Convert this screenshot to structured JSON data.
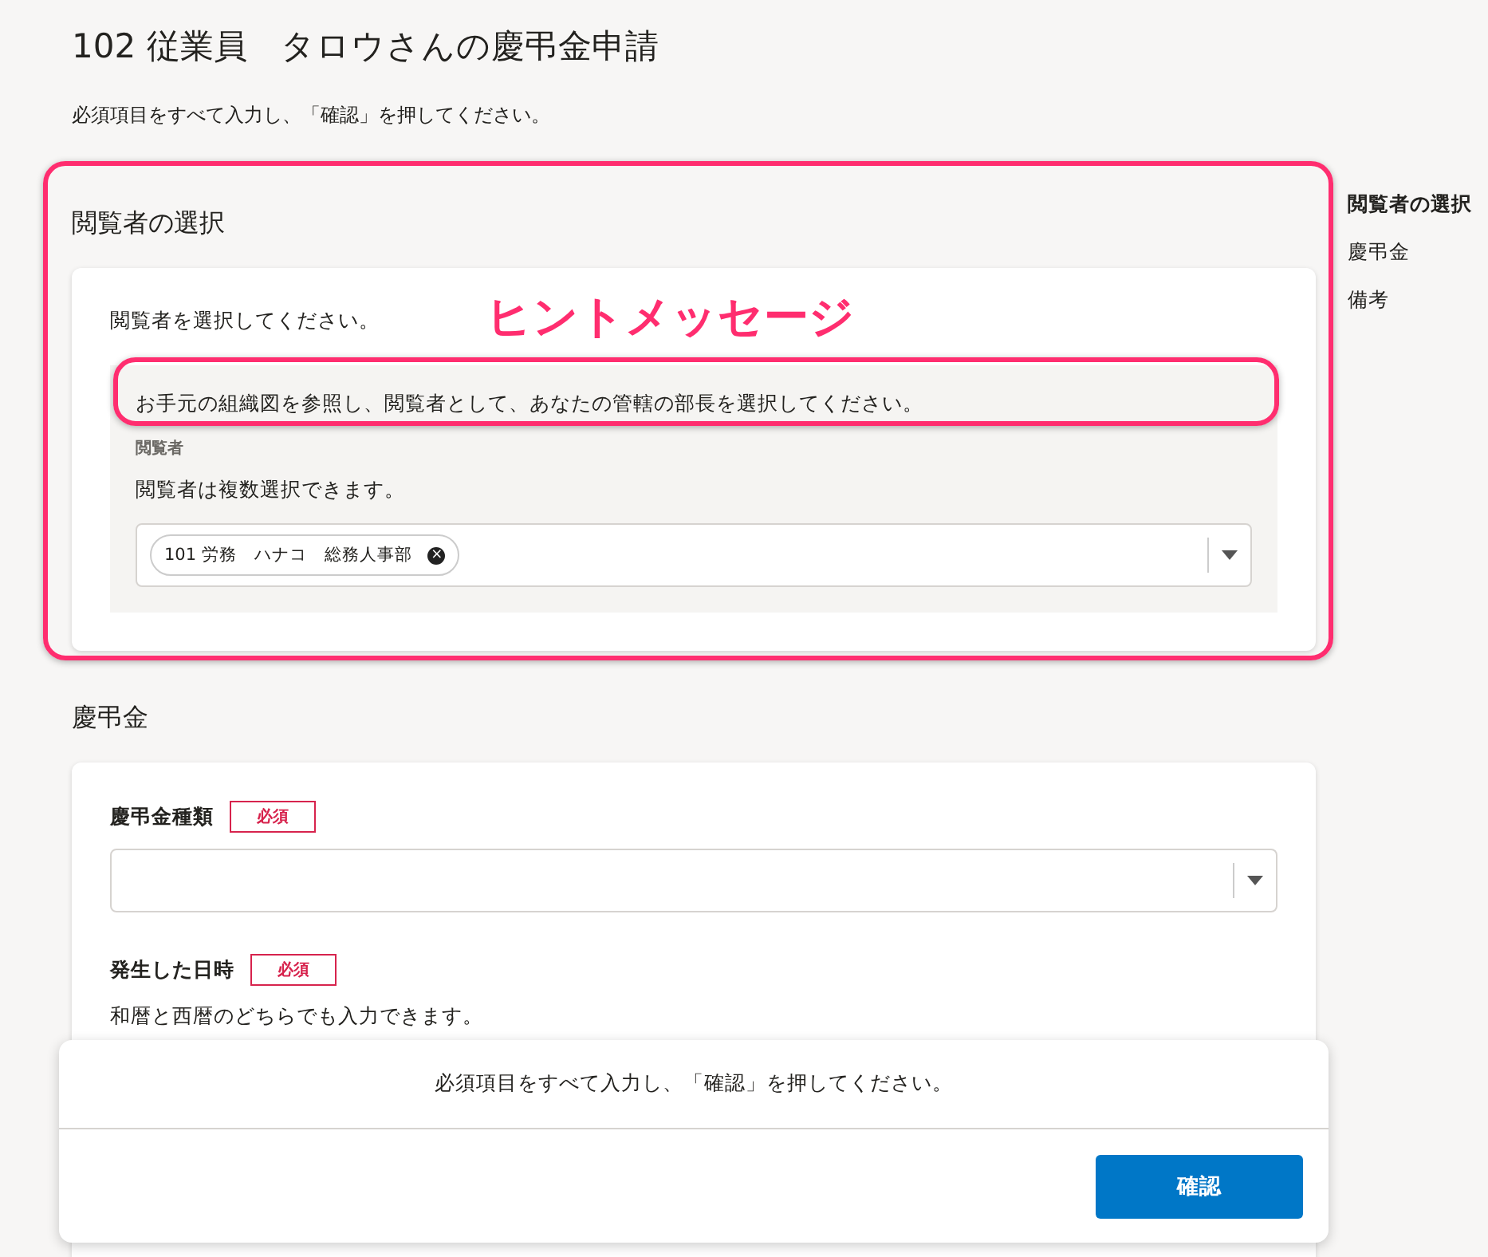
{
  "page": {
    "title": "102 従業員　タロウさんの慶弔金申請",
    "instruction": "必須項目をすべて入力し、「確認」を押してください。"
  },
  "sections": [
    {
      "kind": "viewer",
      "heading": "閲覧者の選択",
      "prompt": "閲覧者を選択してください。",
      "hint": "お手元の組織図を参照し、閲覧者として、あなたの管轄の部長を選択してください。",
      "field_label": "閲覧者",
      "field_note": "閲覧者は複数選択できます。",
      "chips": [
        {
          "label": "101 労務　ハナコ　総務人事部",
          "remove": "×"
        }
      ]
    },
    {
      "kind": "form",
      "heading": "慶弔金",
      "fields": [
        {
          "kind": "select",
          "label": "慶弔金種類",
          "badge": "必須"
        },
        {
          "kind": "text",
          "label": "発生した日時",
          "badge": "必須",
          "note": "和暦と西暦のどちらでも入力できます。"
        }
      ]
    }
  ],
  "nav": [
    {
      "label": "閲覧者の選択",
      "selected": true
    },
    {
      "label": "慶弔金",
      "selected": false
    },
    {
      "label": "備考",
      "selected": false
    }
  ],
  "footer": {
    "message": "必須項目をすべて入力し、「確認」を押してください。",
    "button": "確認"
  },
  "annotation": {
    "label": "ヒントメッセージ"
  }
}
